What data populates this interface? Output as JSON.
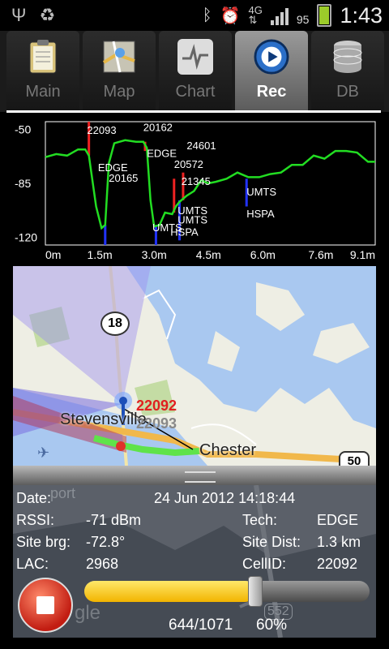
{
  "status_bar": {
    "time": "1:43",
    "battery_pct": "95",
    "network": "4G"
  },
  "tabs": [
    {
      "label": "Main",
      "icon": "clipboard-icon"
    },
    {
      "label": "Map",
      "icon": "map-icon"
    },
    {
      "label": "Chart",
      "icon": "chart-icon"
    },
    {
      "label": "Rec",
      "icon": "record-play-icon",
      "selected": true
    },
    {
      "label": "DB",
      "icon": "database-icon"
    }
  ],
  "chart_data": {
    "type": "line",
    "y_ticks": [
      "-50",
      "-85",
      "-120"
    ],
    "x_ticks": [
      "0m",
      "1.5m",
      "3.0m",
      "4.5m",
      "6.0m",
      "7.6m",
      "9.1m"
    ],
    "ylim": [
      -125,
      -45
    ],
    "xlim": [
      0,
      9.1
    ],
    "series": [
      {
        "color": "#22dd22",
        "points": [
          [
            0,
            -68
          ],
          [
            0.3,
            -66
          ],
          [
            0.6,
            -67
          ],
          [
            0.9,
            -63
          ],
          [
            1.1,
            -63
          ],
          [
            1.2,
            -67
          ],
          [
            1.4,
            -100
          ],
          [
            1.55,
            -114
          ],
          [
            1.65,
            -112
          ],
          [
            1.75,
            -72
          ],
          [
            1.9,
            -59
          ],
          [
            2.2,
            -57
          ],
          [
            2.5,
            -58
          ],
          [
            2.7,
            -58
          ],
          [
            2.8,
            -62
          ],
          [
            2.9,
            -96
          ],
          [
            3.0,
            -113
          ],
          [
            3.15,
            -112
          ],
          [
            3.3,
            -104
          ],
          [
            3.5,
            -105
          ],
          [
            3.6,
            -100
          ],
          [
            3.7,
            -97
          ],
          [
            3.9,
            -93
          ],
          [
            4.1,
            -90
          ],
          [
            4.3,
            -83
          ],
          [
            4.5,
            -85
          ],
          [
            4.7,
            -84
          ],
          [
            5.0,
            -82
          ],
          [
            5.3,
            -78
          ],
          [
            5.6,
            -81
          ],
          [
            5.9,
            -81
          ],
          [
            6.2,
            -79
          ],
          [
            6.5,
            -78
          ],
          [
            6.8,
            -73
          ],
          [
            7.1,
            -73
          ],
          [
            7.4,
            -67
          ],
          [
            7.7,
            -69
          ],
          [
            8.0,
            -64
          ],
          [
            8.3,
            -64
          ],
          [
            8.6,
            -65
          ],
          [
            8.9,
            -71
          ],
          [
            9.1,
            -71
          ]
        ]
      }
    ],
    "markers": [
      {
        "x": 1.2,
        "color": "#ee2222",
        "from": -45,
        "to": -67
      },
      {
        "x": 1.65,
        "color": "#2233ff",
        "from": -112,
        "to": -125
      },
      {
        "x": 2.75,
        "color": "#ee2222",
        "from": -58,
        "to": -64
      },
      {
        "x": 3.05,
        "color": "#2233ff",
        "from": -112,
        "to": -125
      },
      {
        "x": 3.55,
        "color": "#ee2222",
        "from": -82,
        "to": -104
      },
      {
        "x": 3.8,
        "color": "#ee2222",
        "from": -78,
        "to": -96
      },
      {
        "x": 3.7,
        "color": "#2233ff",
        "from": -96,
        "to": -122
      },
      {
        "x": 5.55,
        "color": "#2233ff",
        "from": -82,
        "to": -100
      }
    ],
    "annotations": [
      {
        "x": 1.15,
        "y": -53,
        "text": "22093"
      },
      {
        "x": 2.7,
        "y": -51,
        "text": "20162"
      },
      {
        "x": 1.45,
        "y": -77,
        "text": "EDGE"
      },
      {
        "x": 1.75,
        "y": -84,
        "text": "20165"
      },
      {
        "x": 2.8,
        "y": -68,
        "text": "EDGE"
      },
      {
        "x": 3.9,
        "y": -63,
        "text": "24601"
      },
      {
        "x": 3.55,
        "y": -75,
        "text": "20572"
      },
      {
        "x": 3.75,
        "y": -86,
        "text": "21345"
      },
      {
        "x": 5.55,
        "y": -93,
        "text": "UMTS"
      },
      {
        "x": 5.55,
        "y": -107,
        "text": "HSPA"
      },
      {
        "x": 3.65,
        "y": -105,
        "text": "UMTS"
      },
      {
        "x": 3.65,
        "y": -111,
        "text": "UMTS"
      },
      {
        "x": 2.95,
        "y": -116,
        "text": "UMTS"
      },
      {
        "x": 3.45,
        "y": -119,
        "text": "HSPA"
      }
    ]
  },
  "map": {
    "places": [
      "Stevensville",
      "Chester"
    ],
    "site_labels": [
      "22092",
      "22093"
    ],
    "route_shield": "18",
    "route_shield2": "50",
    "partial_labels": [
      "port",
      "552",
      "gle"
    ]
  },
  "info": {
    "date_label": "Date:",
    "date_value": "24 Jun 2012 14:18:44",
    "rssi_label": "RSSI:",
    "rssi_value": "-71 dBm",
    "tech_label": "Tech:",
    "tech_value": "EDGE",
    "site_brg_label": "Site brg:",
    "site_brg_value": "-72.8°",
    "site_dist_label": "Site Dist:",
    "site_dist_value": "1.3 km",
    "lac_label": "LAC:",
    "lac_value": "2968",
    "cellid_label": "CellID:",
    "cellid_value": "22092"
  },
  "playback": {
    "position": "644/1071",
    "percent": "60%",
    "fraction": 0.6
  }
}
